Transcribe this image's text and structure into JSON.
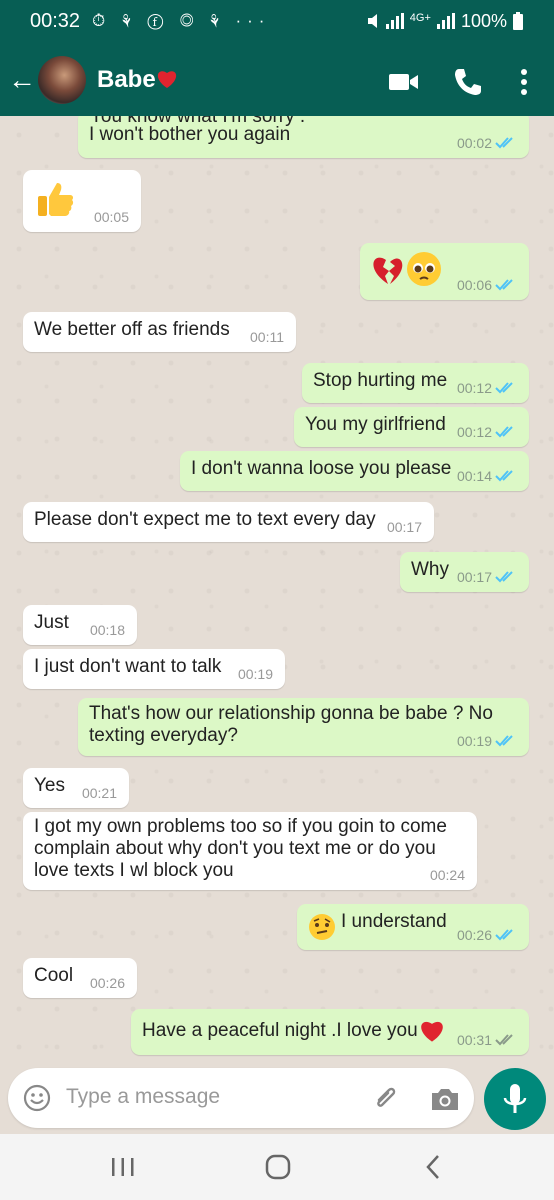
{
  "status_bar": {
    "time": "00:32",
    "notification_icons": "⏱ ⚘ ⓕ ◎ ⚘ ···",
    "network": "4G+",
    "battery": "100%"
  },
  "header": {
    "contact_name": "Babe",
    "back_icon": "back-arrow-icon",
    "video_icon": "video-call-icon",
    "call_icon": "phone-icon",
    "menu_icon": "more-vert-icon"
  },
  "messages": [
    {
      "dir": "out",
      "partial_text": "You know what I'm sorry .",
      "text": "I won't bother you again",
      "time": "00:02",
      "status": "read"
    },
    {
      "dir": "in",
      "emoji": "thumbs-up",
      "time": "00:05"
    },
    {
      "dir": "out",
      "emoji": "broken-heart pleading-face",
      "time": "00:06",
      "status": "read"
    },
    {
      "dir": "in",
      "text": "We better off as friends",
      "time": "00:11"
    },
    {
      "dir": "out",
      "text": "Stop hurting me",
      "time": "00:12",
      "status": "read"
    },
    {
      "dir": "out",
      "text": "You my girlfriend",
      "time": "00:12",
      "status": "read"
    },
    {
      "dir": "out",
      "text": "I don't wanna loose you please",
      "time": "00:14",
      "status": "read"
    },
    {
      "dir": "in",
      "text": "Please don't expect me to text every day",
      "time": "00:17"
    },
    {
      "dir": "out",
      "text": "Why",
      "time": "00:17",
      "status": "read"
    },
    {
      "dir": "in",
      "text": "Just",
      "time": "00:18"
    },
    {
      "dir": "in",
      "text": "I just don't want to talk",
      "time": "00:19"
    },
    {
      "dir": "out",
      "text": "That's how our relationship gonna be babe ? No texting everyday?",
      "time": "00:19",
      "status": "read"
    },
    {
      "dir": "in",
      "text": "Yes",
      "time": "00:21"
    },
    {
      "dir": "in",
      "text": "I got my own problems too so if you goin to come complain about why don't you text me or do you love texts I wl block you",
      "time": "00:24"
    },
    {
      "dir": "out",
      "text": "I understand",
      "emoji": "raised-eyebrow-face",
      "time": "00:26",
      "status": "read"
    },
    {
      "dir": "in",
      "text": "Cool",
      "time": "00:26"
    },
    {
      "dir": "out",
      "text": "Have a peaceful night .I love you",
      "emoji": "red-heart",
      "time": "00:31",
      "status": "delivered"
    }
  ],
  "composer": {
    "placeholder": "Type a message",
    "emoji_icon": "emoji-icon",
    "attach_icon": "paperclip-icon",
    "camera_icon": "camera-icon",
    "mic_icon": "microphone-icon"
  },
  "nav": {
    "recents_icon": "recents-icon",
    "home_icon": "home-icon",
    "back_icon": "nav-back-icon"
  },
  "colors": {
    "header": "#075e54",
    "outgoing": "#dcf8c6",
    "incoming": "#ffffff",
    "read_tick": "#4fc3f7",
    "accent": "#00897b",
    "wallpaper": "#e5ddd5"
  }
}
